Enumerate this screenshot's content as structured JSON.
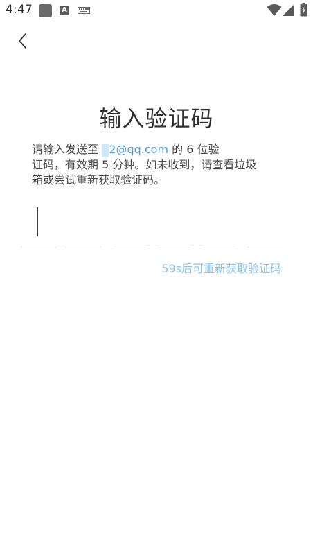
{
  "status_bar": {
    "time": "4:47",
    "a_icon_label": "A",
    "icons": [
      "app-icon",
      "a-icon",
      "keyboard-icon",
      "wifi-icon",
      "signal-icon",
      "battery-charging-icon"
    ]
  },
  "header": {
    "back_icon": "chevron-left-icon"
  },
  "main": {
    "title": "输入验证码",
    "description": {
      "prefix": "请输入发送至 ",
      "email_masked": "1                    ",
      "email_domain": "2@qq.com",
      "suffix_line1": " 的 6 位验",
      "line2": "证码，有效期 5 分钟。如未收到，请查看垃圾",
      "line3": "箱或尝试重新获取验证码。"
    },
    "code_length": 6,
    "code_value": "",
    "resend_label": "59s后可重新获取验证码"
  },
  "colors": {
    "link": "#4a9bdf",
    "resend_disabled": "#8cc5ee",
    "mask": "#cfe9fb"
  }
}
